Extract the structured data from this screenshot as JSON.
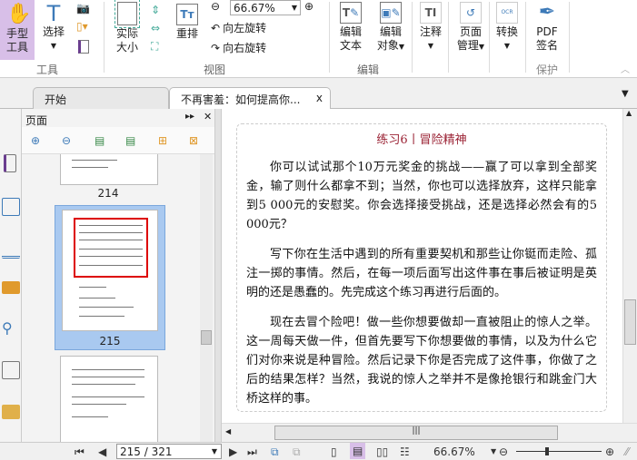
{
  "ribbon": {
    "hand_tool": "手型工具",
    "hand_tool_l1": "手型",
    "hand_tool_l2": "工具",
    "select": "选择",
    "actual_size_l1": "实际",
    "actual_size_l2": "大小",
    "reflow": "重排",
    "zoom_value": "66.67%",
    "rotate_left": "向左旋转",
    "rotate_right": "向右旋转",
    "edit_text_l1": "编辑",
    "edit_text_l2": "文本",
    "edit_object_l1": "编辑",
    "edit_object_l2": "对象",
    "comment": "注释",
    "page_manage_l1": "页面",
    "page_manage_l2": "管理",
    "convert": "转换",
    "pdf_sign_l1": "PDF",
    "pdf_sign_l2": "签名",
    "groups": {
      "tools": "工具",
      "view": "视图",
      "edit": "编辑",
      "protect": "保护"
    }
  },
  "tabs": [
    {
      "label": "开始"
    },
    {
      "label": "不再害羞：如何提高你...",
      "close": "x"
    }
  ],
  "sidebar": {
    "title": "页面",
    "thumbs": [
      {
        "page": "214"
      },
      {
        "page": "215"
      }
    ]
  },
  "document": {
    "heading": "练习6丨冒险精神",
    "paragraphs": [
      "你可以试试那个10万元奖金的挑战——赢了可以拿到全部奖金，输了则什么都拿不到；当然，你也可以选择放弃，这样只能拿到5 000元的安慰奖。你会选择接受挑战，还是选择必然会有的5 000元？",
      "写下你在生活中遇到的所有重要契机和那些让你铤而走险、孤注一掷的事情。然后，在每一项后面写出这件事在事后被证明是英明的还是愚蠢的。先完成这个练习再进行后面的。",
      "现在去冒个险吧！做一些你想要做却一直被阻止的惊人之举。这一周每天做一件，但首先要写下你想要做的事情，以及为什么它们对你来说是种冒险。然后记录下你是否完成了这件事，你做了之后的结果怎样？当然，我说的惊人之举并不是像抢银行和跳金门大桥这样的事。"
    ]
  },
  "status": {
    "page_input": "215 / 321",
    "zoom": "66.67%",
    "zoom_slider_fraction": 0.35
  },
  "colors": {
    "accent": "#d8bfe8",
    "heading": "#9b2335",
    "thumb_sel": "#a9c9f0",
    "icon_blue": "#3d7ab8"
  }
}
